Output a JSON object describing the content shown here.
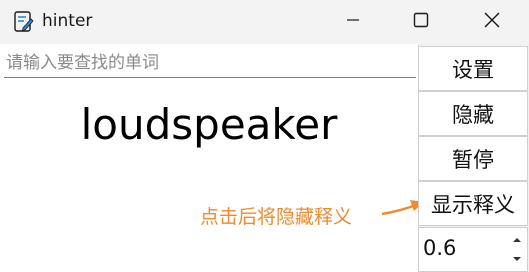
{
  "window": {
    "title": "hinter",
    "icons": {
      "app": "edit-document-icon",
      "minimize": "minimize-icon",
      "maximize": "maximize-icon",
      "close": "close-icon"
    }
  },
  "search": {
    "placeholder": "请输入要查找的单词",
    "value": ""
  },
  "main": {
    "word": "loudspeaker"
  },
  "annotation": {
    "text": "点击后将隐藏释义",
    "color": "#f08a2c"
  },
  "sidebar": {
    "buttons": [
      {
        "label": "设置"
      },
      {
        "label": "隐藏"
      },
      {
        "label": "暂停"
      },
      {
        "label": "显示释义"
      }
    ],
    "spinner": {
      "value": "0.6"
    }
  }
}
